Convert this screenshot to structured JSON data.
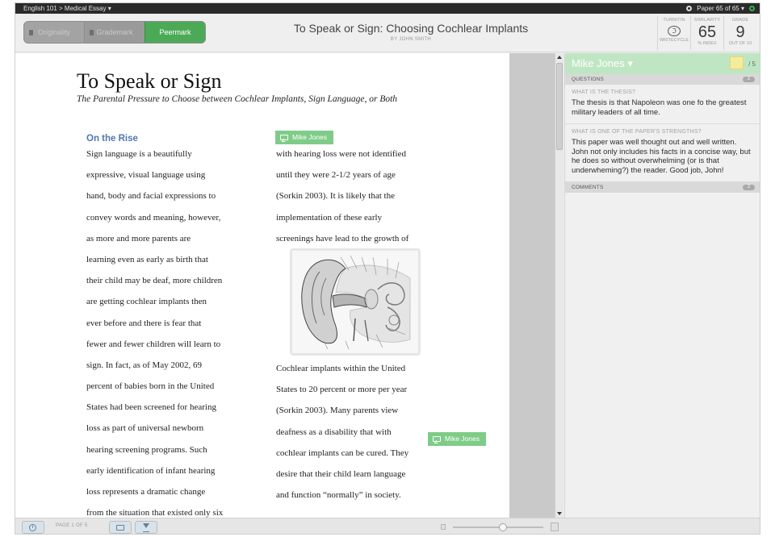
{
  "topbar": {
    "breadcrumb": "English 101 > Medical Essay ▾",
    "paper_count": "Paper 65 of 65 ▾"
  },
  "modes": [
    {
      "label": "Originality",
      "active": false
    },
    {
      "label": "Grademark",
      "active": false
    },
    {
      "label": "Peermark",
      "active": true
    }
  ],
  "header": {
    "title": "To Speak or Sign: Choosing Cochlear Implants",
    "author": "BY JOHN SMITH"
  },
  "scores": {
    "turnitin": {
      "label": "TURNITIN",
      "sub": "WRITECYCLE",
      "icon": "turnitin-logo-icon"
    },
    "similarity": {
      "label": "SIMILARITY",
      "value": "65",
      "sub": "% INDEX"
    },
    "grade": {
      "label": "GRADE",
      "value": "9",
      "sub": "OUT OF 10"
    }
  },
  "doc": {
    "title": "To Speak or Sign",
    "subtitle": "The Parental Pressure to Choose between Cochlear Implants, Sign Language, or Both",
    "section_heading": "On the Rise",
    "col1_lines": [
      "           Sign language is a beautifully",
      "expressive, visual language using",
      "hand, body and facial expressions to",
      "convey words and meaning, however,",
      "as more and more parents are",
      "learning even as early as birth that",
      "their child may be deaf, more children",
      "are getting cochlear implants then",
      "ever before and there is fear that",
      "fewer and fewer children will learn to",
      "sign.   In fact, as of May 2002, 69",
      "percent of babies born in the United",
      "States had been screened for hearing",
      "loss as part of universal newborn",
      "hearing screening programs. Such",
      "early identification of infant hearing",
      "loss represents a dramatic change",
      "from the situation that existed only six"
    ],
    "col2a_lines": [
      "with hearing loss were not identified",
      "until they were 2-1/2 years of age",
      "(Sorkin 2003).  It is likely that the",
      "implementation of these early",
      "screenings have lead to the growth of"
    ],
    "col2b_lines": [
      "Cochlear implants within the United",
      "States to 20 percent or more per year",
      "(Sorkin 2003).  Many parents view",
      "deafness as a disability that with",
      "cochlear implants can be cured.  They",
      "desire that their child learn language",
      "and function “normally” in society."
    ],
    "annotations": [
      {
        "author": "Mike Jones"
      },
      {
        "author": "Mike Jones"
      }
    ]
  },
  "panel": {
    "reviewer": "Mike Jones ▾",
    "score_max": "/ 5",
    "questions_label": "QUESTIONS",
    "questions_count": "2",
    "questions": [
      {
        "q": "WHAT IS THE THESIS?",
        "a": "The thesis is that Napoleon was one fo the greatest military leaders of all time."
      },
      {
        "q": "WHAT IS ONE OF THE PAPER'S STRENGTHS?",
        "a": "This paper was well thought out and well written. John not only includes his facts in a concise way, but he does so without overwhelming (or is that underwheming?) the reader. Good job, John!"
      }
    ],
    "comments_label": "COMMENTS",
    "comments_count": "2"
  },
  "bottombar": {
    "page_indicator": "PAGE 1 OF 5",
    "zoom_level": 0.55
  },
  "colors": {
    "accent_green": "#4caa57",
    "annotation_green": "#7fcc88",
    "heading_blue": "#5277ad"
  }
}
